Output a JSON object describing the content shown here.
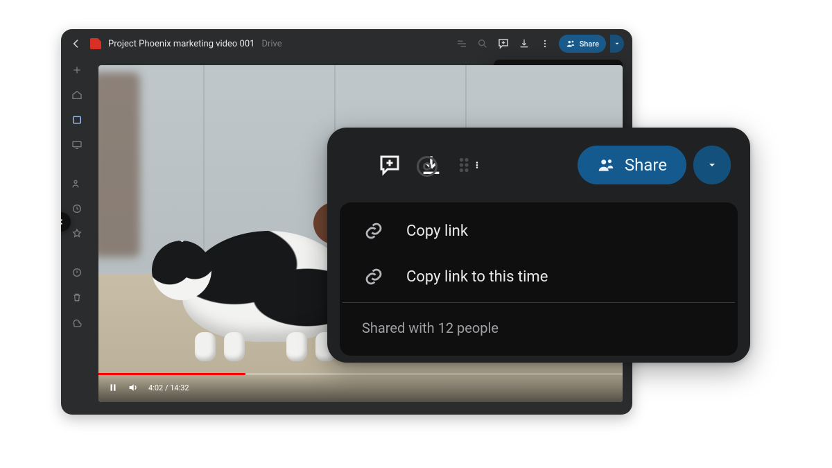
{
  "header": {
    "title": "Project Phoenix marketing video 001",
    "context_label": "Drive"
  },
  "player": {
    "current_time": "4:02",
    "total_time": "14:32",
    "progress_pct": 28
  },
  "top_actions": {
    "share_label": "Share"
  },
  "share_menu": {
    "copy_link": "Copy link",
    "copy_link_time": "Copy link to this time",
    "shared_with": "Shared with 12 people"
  },
  "overlay": {
    "share_label": "Share",
    "menu": {
      "copy_link": "Copy link",
      "copy_link_time": "Copy link to this time",
      "shared_with": "Shared with 12 people"
    }
  },
  "colors": {
    "accent": "#155a8e",
    "accent_dark": "#13507c",
    "panel": "#202122",
    "menu_bg": "#0f0f10"
  }
}
